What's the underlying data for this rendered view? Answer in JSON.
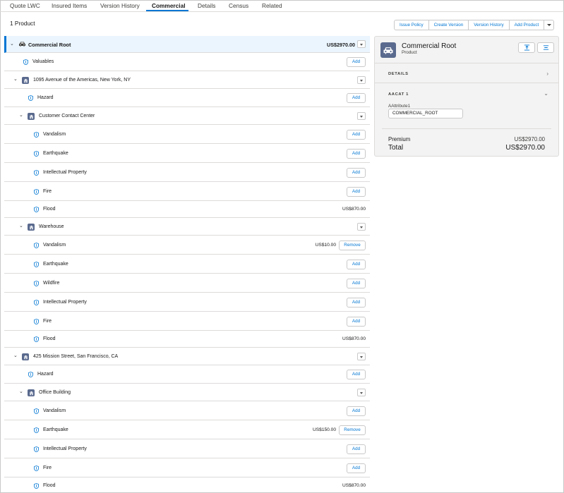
{
  "tabs": [
    {
      "label": "Quote LWC"
    },
    {
      "label": "Insured Items"
    },
    {
      "label": "Version History"
    },
    {
      "label": "Commercial",
      "active": true
    },
    {
      "label": "Details"
    },
    {
      "label": "Census"
    },
    {
      "label": "Related"
    }
  ],
  "product_count": "1 Product",
  "actions": {
    "issue_policy": "Issue Policy",
    "create_version": "Create Version",
    "version_history": "Version History",
    "add_product": "Add Product"
  },
  "tree": {
    "root": {
      "label": "Commercial Root",
      "price": "US$2970.00"
    },
    "rows": [
      {
        "label": "Valuables",
        "button": "Add"
      },
      {
        "label": "1095 Avenue of the Americas, New York, NY"
      },
      {
        "label": "Hazard",
        "button": "Add"
      },
      {
        "label": "Customer Contact Center"
      },
      {
        "label": "Vandalism",
        "button": "Add"
      },
      {
        "label": "Earthquake",
        "button": "Add"
      },
      {
        "label": "Intellectual Property",
        "button": "Add"
      },
      {
        "label": "Fire",
        "button": "Add"
      },
      {
        "label": "Flood",
        "price": "US$870.00"
      },
      {
        "label": "Warehouse"
      },
      {
        "label": "Vandalism",
        "price": "US$10.00",
        "button": "Remove"
      },
      {
        "label": "Earthquake",
        "button": "Add"
      },
      {
        "label": "Wildfire",
        "button": "Add"
      },
      {
        "label": "Intellectual Property",
        "button": "Add"
      },
      {
        "label": "Fire",
        "button": "Add"
      },
      {
        "label": "Flood",
        "price": "US$870.00"
      },
      {
        "label": "425 Mission Street, San Francisco, CA"
      },
      {
        "label": "Hazard",
        "button": "Add"
      },
      {
        "label": "Office Building"
      },
      {
        "label": "Vandalism",
        "button": "Add"
      },
      {
        "label": "Earthquake",
        "price": "US$150.00",
        "button": "Remove"
      },
      {
        "label": "Intellectual Property",
        "button": "Add"
      },
      {
        "label": "Fire",
        "button": "Add"
      },
      {
        "label": "Flood",
        "price": "US$870.00"
      }
    ]
  },
  "panel": {
    "title": "Commercial Root",
    "subtitle": "Product",
    "details_title": "DETAILS",
    "aacat_title": "AACAT 1",
    "attribute_label": "AAttribute1",
    "attribute_value": "COMMERCIAL_ROOT",
    "premium_label": "Premium",
    "premium_value": "US$2970.00",
    "total_label": "Total",
    "total_value": "US$2970.00"
  },
  "colors": {
    "accent": "#0176d3",
    "root_bg": "#eaf5fe",
    "icon_bg": "#5a6a8e",
    "shield": "#0176d3"
  }
}
